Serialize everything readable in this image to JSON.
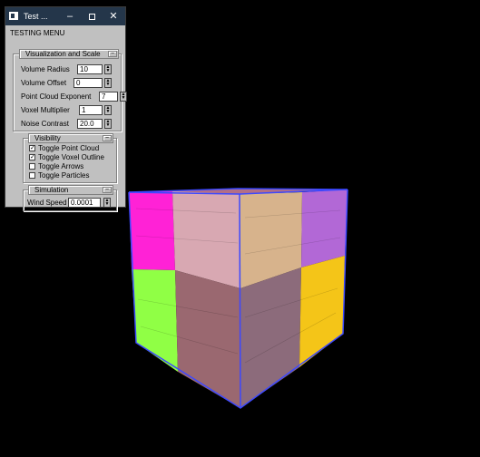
{
  "window": {
    "title": "Test ...",
    "menu_label": "TESTING MENU",
    "icons": {
      "app": "app-icon",
      "minimize": "minimize-icon",
      "maximize": "maximize-icon",
      "close": "close-icon"
    },
    "colors": {
      "titlebar": "#24364a",
      "panel": "#c0c0c0",
      "viewport": "#000000"
    }
  },
  "panels": {
    "visualization": {
      "title": "Visualization and Scale",
      "fields": [
        {
          "label": "Volume Radius",
          "value": "10"
        },
        {
          "label": "Volume Offset",
          "value": "0"
        },
        {
          "label": "Point Cloud Exponent",
          "value": "7"
        },
        {
          "label": "Voxel Multiplier",
          "value": "1"
        },
        {
          "label": "Noise Contrast",
          "value": "20.0"
        }
      ]
    },
    "visibility": {
      "title": "Visibility",
      "checkboxes": [
        {
          "label": "Toggle Point Cloud",
          "checked": true
        },
        {
          "label": "Toggle Voxel Outline",
          "checked": true
        },
        {
          "label": "Toggle Arrows",
          "checked": false
        },
        {
          "label": "Toggle Particles",
          "checked": false
        }
      ]
    },
    "simulation": {
      "title": "Simulation",
      "fields": [
        {
          "label": "Wind Speed",
          "value": "0.0001"
        }
      ]
    }
  },
  "scene": {
    "cube_colors": {
      "top": [
        "#ff1ed2",
        "#d68fa2",
        "#d89678",
        "#c43ee6"
      ],
      "left": [
        "#d70ec8",
        "#b6a3a8",
        "#8aff3c",
        "#9a6a6e"
      ],
      "right": [
        "#d3b487",
        "#a06cd4",
        "#8e6a7a",
        "#f2c410"
      ],
      "edge": "#3c48ff"
    }
  }
}
